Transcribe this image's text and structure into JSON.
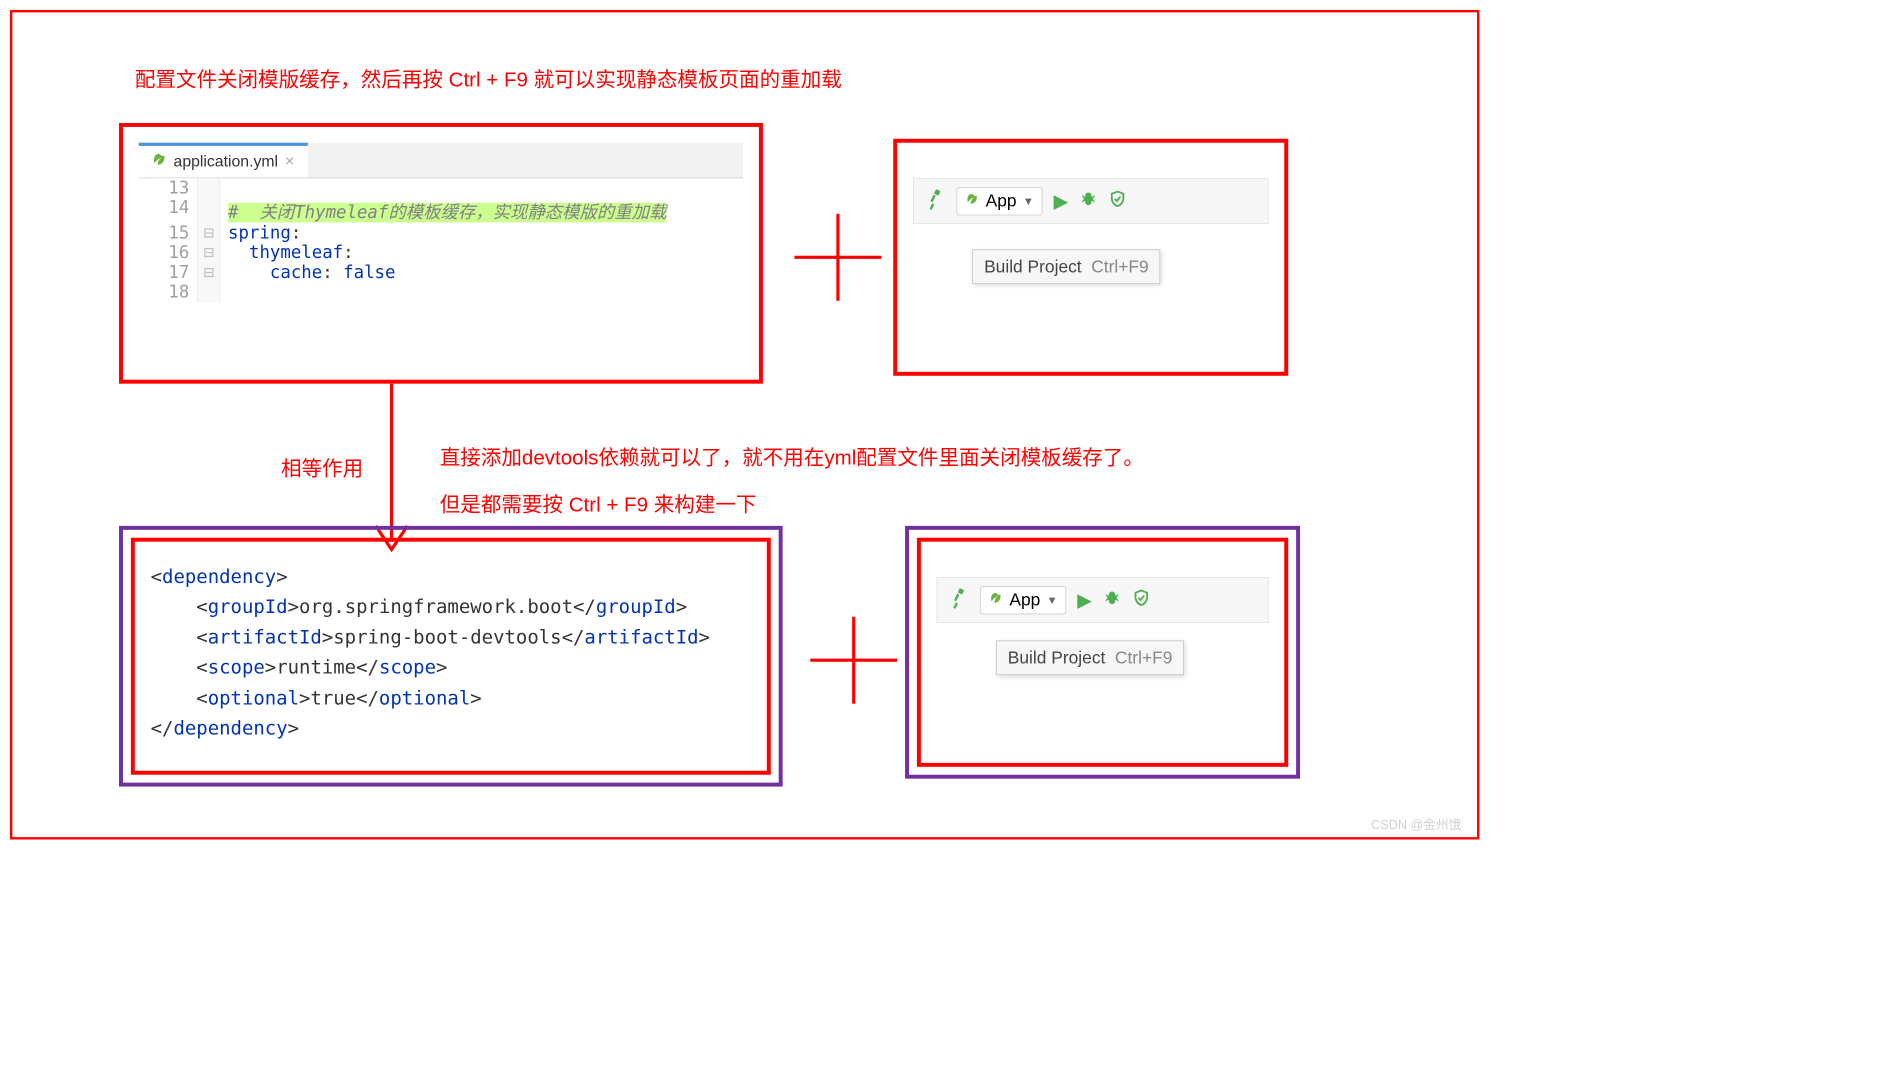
{
  "heading": "配置文件关闭模版缓存，然后再按 Ctrl + F9 就可以实现静态模板页面的重加载",
  "editor": {
    "tab_label": "application.yml",
    "lines": [
      {
        "no": "13",
        "fold": "",
        "segs": []
      },
      {
        "no": "14",
        "fold": "",
        "segs": [
          {
            "cls": "hl-comment",
            "t": "#  关闭Thymeleaf的模板缓存，实现静态模版的重加载"
          }
        ]
      },
      {
        "no": "15",
        "fold": "⊟",
        "segs": [
          {
            "cls": "hl-key",
            "t": "spring"
          },
          {
            "cls": "xml-txt",
            "t": ":"
          }
        ]
      },
      {
        "no": "16",
        "fold": "⊟",
        "segs": [
          {
            "cls": "",
            "t": "  "
          },
          {
            "cls": "hl-key",
            "t": "thymeleaf"
          },
          {
            "cls": "xml-txt",
            "t": ":"
          }
        ]
      },
      {
        "no": "17",
        "fold": "⊟",
        "segs": [
          {
            "cls": "",
            "t": "    "
          },
          {
            "cls": "hl-key",
            "t": "cache"
          },
          {
            "cls": "xml-txt",
            "t": ": "
          },
          {
            "cls": "hl-key",
            "t": "false"
          }
        ]
      },
      {
        "no": "18",
        "fold": "",
        "segs": []
      }
    ]
  },
  "toolbars": {
    "run_config": "App",
    "tooltip_label": "Build Project",
    "tooltip_shortcut": "Ctrl+F9"
  },
  "mid_texts": {
    "equal_effect": "相等作用",
    "line1": "直接添加devtools依赖就可以了，就不用在yml配置文件里面关闭模板缓存了。",
    "line2": "但是都需要按 Ctrl + F9 来构建一下"
  },
  "dependency": {
    "l1_open": "dependency",
    "groupId_tag": "groupId",
    "groupId_val": "org.springframework.boot",
    "artifactId_tag": "artifactId",
    "artifactId_val": "spring-boot-devtools",
    "scope_tag": "scope",
    "scope_val": "runtime",
    "optional_tag": "optional",
    "optional_val": "true"
  },
  "watermark": "CSDN @金州饿"
}
